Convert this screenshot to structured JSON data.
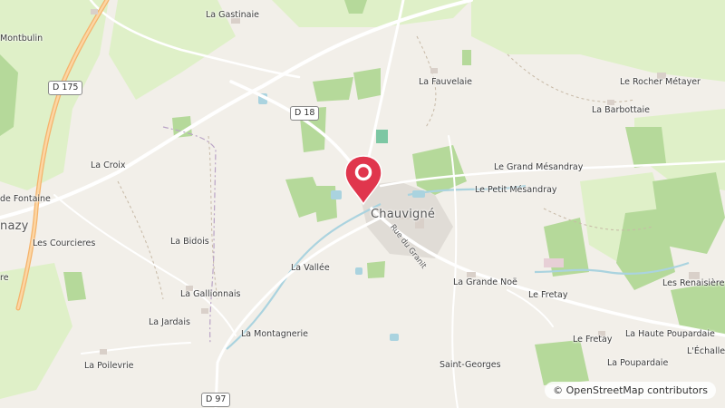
{
  "map": {
    "center_label": "Chauvigné",
    "street_label": "Rue du Granit",
    "road_shields": [
      "D 175",
      "D 18",
      "D 97"
    ],
    "places": [
      "La Gastinaie",
      "Montbulin",
      "La Fauvelaie",
      "Le Rocher Métayer",
      "La Barbottaie",
      "La Croix",
      "de Fontaine",
      "nazy",
      "Les Courcieres",
      "La Bidois",
      "Le Grand Mésandray",
      "Le Petit Mésandray",
      "La Vallée",
      "La Grande Noë",
      "Le Fretay",
      "La Gallionnais",
      "La Jardais",
      "La Montagnerie",
      "Le Fretay",
      "La Haute Poupardaie",
      "Les Renaisières",
      "L'Échalle",
      "La Poupardaie",
      "Saint-Georges",
      "La Poilevrie",
      "re"
    ],
    "marker": "location-pin",
    "colors": {
      "land": "#f2efe9",
      "wood": "#b5d99a",
      "meadow": "#dff0c8",
      "water": "#aad3df",
      "pin": "#e0364d"
    }
  },
  "attribution": {
    "symbol": "©",
    "text": "OpenStreetMap contributors"
  }
}
